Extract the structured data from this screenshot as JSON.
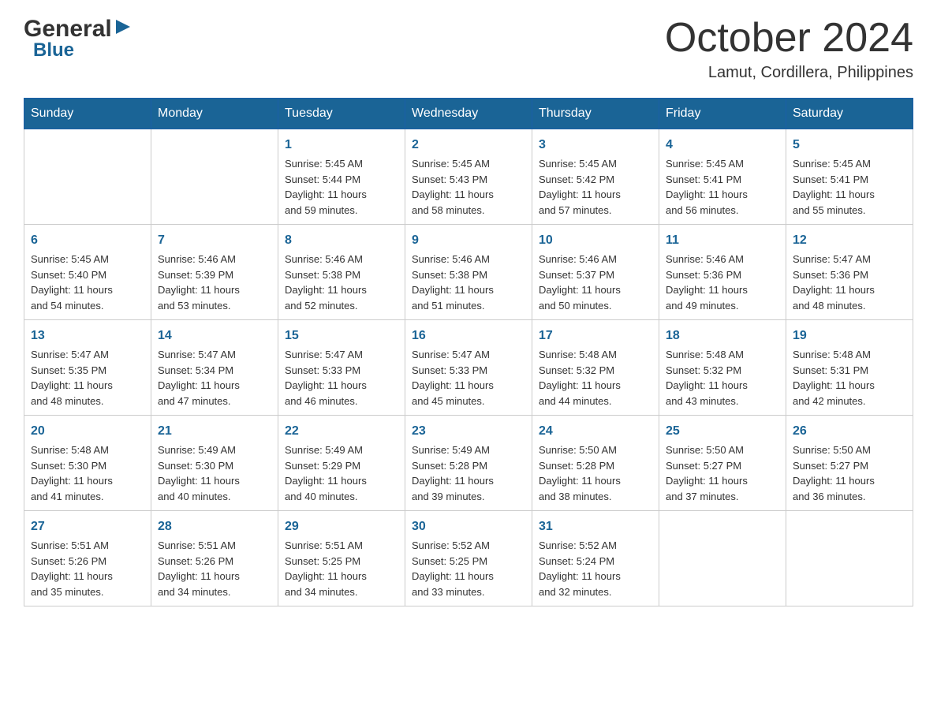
{
  "header": {
    "logo_general": "General",
    "logo_blue": "Blue",
    "month_title": "October 2024",
    "location": "Lamut, Cordillera, Philippines"
  },
  "calendar": {
    "days_of_week": [
      "Sunday",
      "Monday",
      "Tuesday",
      "Wednesday",
      "Thursday",
      "Friday",
      "Saturday"
    ],
    "weeks": [
      [
        {
          "day": "",
          "info": ""
        },
        {
          "day": "",
          "info": ""
        },
        {
          "day": "1",
          "info": "Sunrise: 5:45 AM\nSunset: 5:44 PM\nDaylight: 11 hours\nand 59 minutes."
        },
        {
          "day": "2",
          "info": "Sunrise: 5:45 AM\nSunset: 5:43 PM\nDaylight: 11 hours\nand 58 minutes."
        },
        {
          "day": "3",
          "info": "Sunrise: 5:45 AM\nSunset: 5:42 PM\nDaylight: 11 hours\nand 57 minutes."
        },
        {
          "day": "4",
          "info": "Sunrise: 5:45 AM\nSunset: 5:41 PM\nDaylight: 11 hours\nand 56 minutes."
        },
        {
          "day": "5",
          "info": "Sunrise: 5:45 AM\nSunset: 5:41 PM\nDaylight: 11 hours\nand 55 minutes."
        }
      ],
      [
        {
          "day": "6",
          "info": "Sunrise: 5:45 AM\nSunset: 5:40 PM\nDaylight: 11 hours\nand 54 minutes."
        },
        {
          "day": "7",
          "info": "Sunrise: 5:46 AM\nSunset: 5:39 PM\nDaylight: 11 hours\nand 53 minutes."
        },
        {
          "day": "8",
          "info": "Sunrise: 5:46 AM\nSunset: 5:38 PM\nDaylight: 11 hours\nand 52 minutes."
        },
        {
          "day": "9",
          "info": "Sunrise: 5:46 AM\nSunset: 5:38 PM\nDaylight: 11 hours\nand 51 minutes."
        },
        {
          "day": "10",
          "info": "Sunrise: 5:46 AM\nSunset: 5:37 PM\nDaylight: 11 hours\nand 50 minutes."
        },
        {
          "day": "11",
          "info": "Sunrise: 5:46 AM\nSunset: 5:36 PM\nDaylight: 11 hours\nand 49 minutes."
        },
        {
          "day": "12",
          "info": "Sunrise: 5:47 AM\nSunset: 5:36 PM\nDaylight: 11 hours\nand 48 minutes."
        }
      ],
      [
        {
          "day": "13",
          "info": "Sunrise: 5:47 AM\nSunset: 5:35 PM\nDaylight: 11 hours\nand 48 minutes."
        },
        {
          "day": "14",
          "info": "Sunrise: 5:47 AM\nSunset: 5:34 PM\nDaylight: 11 hours\nand 47 minutes."
        },
        {
          "day": "15",
          "info": "Sunrise: 5:47 AM\nSunset: 5:33 PM\nDaylight: 11 hours\nand 46 minutes."
        },
        {
          "day": "16",
          "info": "Sunrise: 5:47 AM\nSunset: 5:33 PM\nDaylight: 11 hours\nand 45 minutes."
        },
        {
          "day": "17",
          "info": "Sunrise: 5:48 AM\nSunset: 5:32 PM\nDaylight: 11 hours\nand 44 minutes."
        },
        {
          "day": "18",
          "info": "Sunrise: 5:48 AM\nSunset: 5:32 PM\nDaylight: 11 hours\nand 43 minutes."
        },
        {
          "day": "19",
          "info": "Sunrise: 5:48 AM\nSunset: 5:31 PM\nDaylight: 11 hours\nand 42 minutes."
        }
      ],
      [
        {
          "day": "20",
          "info": "Sunrise: 5:48 AM\nSunset: 5:30 PM\nDaylight: 11 hours\nand 41 minutes."
        },
        {
          "day": "21",
          "info": "Sunrise: 5:49 AM\nSunset: 5:30 PM\nDaylight: 11 hours\nand 40 minutes."
        },
        {
          "day": "22",
          "info": "Sunrise: 5:49 AM\nSunset: 5:29 PM\nDaylight: 11 hours\nand 40 minutes."
        },
        {
          "day": "23",
          "info": "Sunrise: 5:49 AM\nSunset: 5:28 PM\nDaylight: 11 hours\nand 39 minutes."
        },
        {
          "day": "24",
          "info": "Sunrise: 5:50 AM\nSunset: 5:28 PM\nDaylight: 11 hours\nand 38 minutes."
        },
        {
          "day": "25",
          "info": "Sunrise: 5:50 AM\nSunset: 5:27 PM\nDaylight: 11 hours\nand 37 minutes."
        },
        {
          "day": "26",
          "info": "Sunrise: 5:50 AM\nSunset: 5:27 PM\nDaylight: 11 hours\nand 36 minutes."
        }
      ],
      [
        {
          "day": "27",
          "info": "Sunrise: 5:51 AM\nSunset: 5:26 PM\nDaylight: 11 hours\nand 35 minutes."
        },
        {
          "day": "28",
          "info": "Sunrise: 5:51 AM\nSunset: 5:26 PM\nDaylight: 11 hours\nand 34 minutes."
        },
        {
          "day": "29",
          "info": "Sunrise: 5:51 AM\nSunset: 5:25 PM\nDaylight: 11 hours\nand 34 minutes."
        },
        {
          "day": "30",
          "info": "Sunrise: 5:52 AM\nSunset: 5:25 PM\nDaylight: 11 hours\nand 33 minutes."
        },
        {
          "day": "31",
          "info": "Sunrise: 5:52 AM\nSunset: 5:24 PM\nDaylight: 11 hours\nand 32 minutes."
        },
        {
          "day": "",
          "info": ""
        },
        {
          "day": "",
          "info": ""
        }
      ]
    ]
  }
}
